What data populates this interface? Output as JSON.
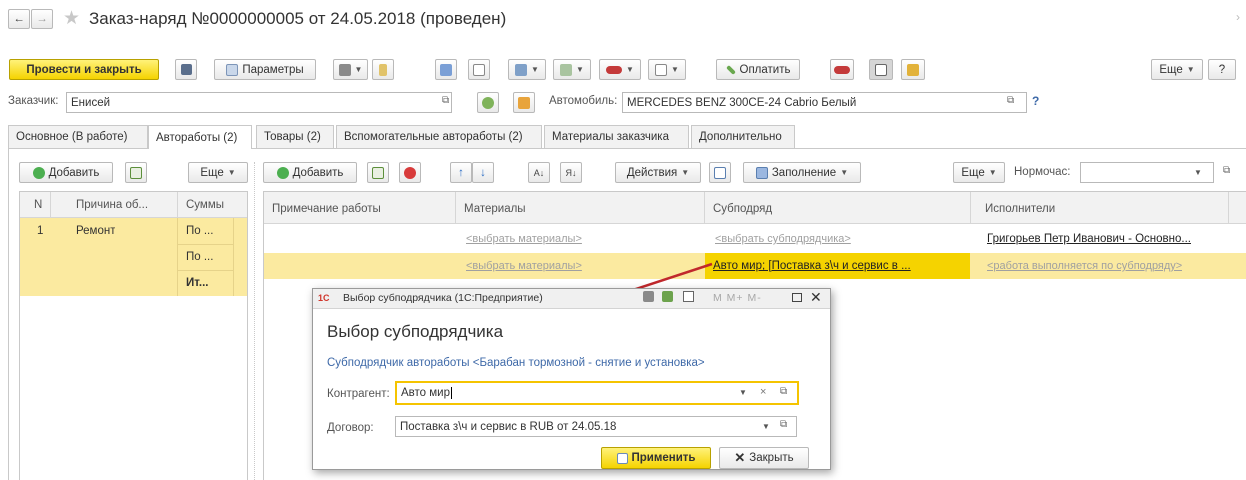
{
  "window": {
    "back": "←",
    "forward": "→",
    "star": "★",
    "title": "Заказ-наряд №0000000005 от 24.05.2018 (проведен)"
  },
  "toolbar": {
    "post_close": "Провести и закрыть",
    "params": "Параметры",
    "pay": "Оплатить",
    "more": "Еще",
    "help": "?"
  },
  "header": {
    "customer_label": "Заказчик:",
    "customer_value": "Енисей",
    "car_label": "Автомобиль:",
    "car_value": "MERCEDES BENZ 300CE-24 Cabrio Белый",
    "help": "?"
  },
  "tabs": [
    {
      "label": "Основное (В работе)"
    },
    {
      "label": "Автоработы (2)"
    },
    {
      "label": "Товары (2)"
    },
    {
      "label": "Вспомогательные автоработы (2)"
    },
    {
      "label": "Материалы заказчика"
    },
    {
      "label": "Дополнительно"
    }
  ],
  "left_panel": {
    "add": "Добавить",
    "more": "Еще",
    "columns": [
      "N",
      "Причина об...",
      "Суммы"
    ],
    "rows": [
      {
        "n": "1",
        "reason": "Ремонт",
        "sum": "По ..."
      },
      {
        "n": "",
        "reason": "",
        "sum": "По ..."
      },
      {
        "n": "",
        "reason": "",
        "sum": "Ит..."
      }
    ]
  },
  "right_panel": {
    "add": "Добавить",
    "actions": "Действия",
    "fill": "Заполнение",
    "more": "Еще",
    "norm_label": "Нормочас:",
    "norm_value": "",
    "columns": [
      "Примечание работы",
      "Материалы",
      "Субподряд",
      "Исполнители"
    ],
    "rows": [
      {
        "note": "",
        "materials": "<выбрать материалы>",
        "subcontract": "<выбрать субподрядчика>",
        "performers": "Григорьев Петр Иванович - Основно..."
      },
      {
        "note": "",
        "materials": "<выбрать материалы>",
        "subcontract": "Авто мир;  [Поставка з\\ч и сервис в ...",
        "performers": "<работа выполняется по субподряду>"
      }
    ]
  },
  "dialog": {
    "app_icon": "1С",
    "caption": "Выбор субподрядчика  (1С:Предприятие)",
    "calc_buttons": "M  M+  M-",
    "heading": "Выбор субподрядчика",
    "subtitle": "Субподрядчик автоработы <Барабан тормозной - снятие и установка>",
    "counterparty_label": "Контрагент:",
    "counterparty_value": "Авто мир",
    "contract_label": "Договор:",
    "contract_value": "Поставка з\\ч и сервис в RUB от 24.05.18",
    "apply": "Применить",
    "close": "Закрыть"
  },
  "colors": {
    "accent_yellow": "#f5d300",
    "selected_row": "#fbeaa0",
    "link_blue": "#3e69a8",
    "arrow_red": "#c0282c"
  }
}
